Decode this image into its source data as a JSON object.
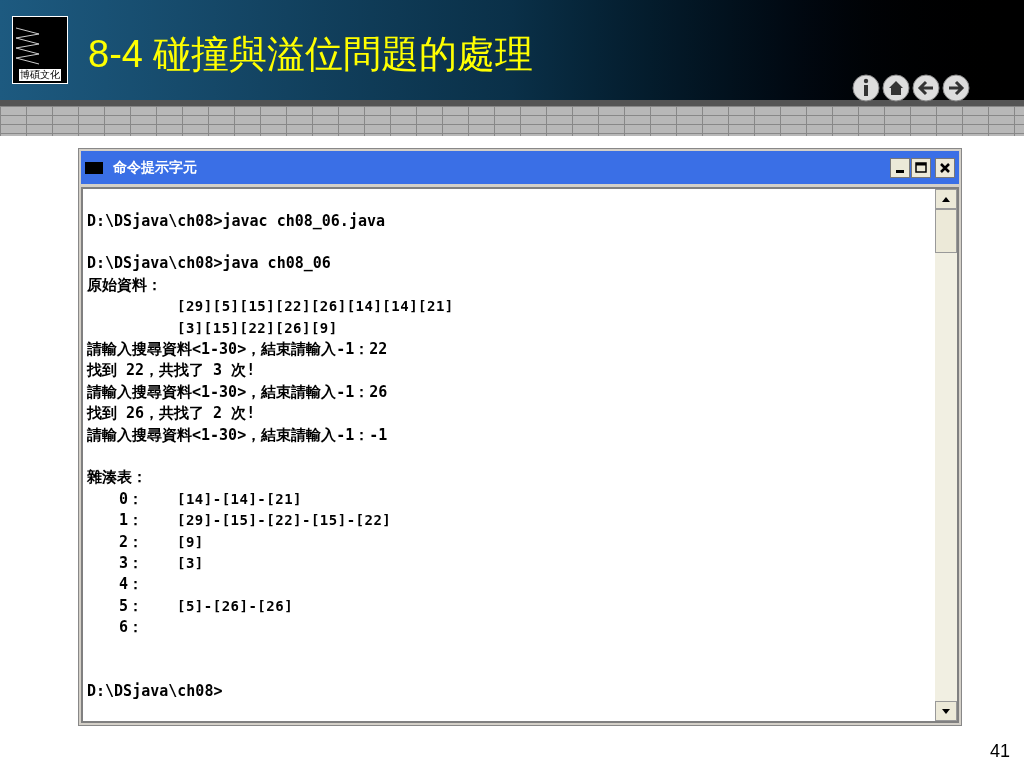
{
  "slide": {
    "logo_text": "博碩文化",
    "title": "8-4 碰撞與溢位問題的處理",
    "page_number": "41"
  },
  "window": {
    "title": "命令提示字元",
    "console": {
      "compile_command": "D:\\DSjava\\ch08>javac ch08_06.java",
      "run_command": "D:\\DSjava\\ch08>java ch08_06",
      "output_lines": [
        {
          "kind": "plain",
          "text": "原始資料："
        },
        {
          "kind": "indented",
          "text": "[29][5][15][22][26][14][14][21]"
        },
        {
          "kind": "indented",
          "text": "[3][15][22][26][9]"
        },
        {
          "kind": "plain",
          "text": "請輸入搜尋資料<1-30>，結束請輸入-1：22"
        },
        {
          "kind": "plain",
          "text": "找到 22，共找了 3 次!"
        },
        {
          "kind": "plain",
          "text": "請輸入搜尋資料<1-30>，結束請輸入-1：26"
        },
        {
          "kind": "plain",
          "text": "找到 26，共找了 2 次!"
        },
        {
          "kind": "plain",
          "text": "請輸入搜尋資料<1-30>，結束請輸入-1：-1"
        }
      ],
      "hash_table": {
        "title": "雜湊表：",
        "rows": [
          {
            "index": "0：",
            "values": "[14]-[14]-[21]"
          },
          {
            "index": "1：",
            "values": "[29]-[15]-[22]-[15]-[22]"
          },
          {
            "index": "2：",
            "values": "[9]"
          },
          {
            "index": "3：",
            "values": "[3]"
          },
          {
            "index": "4："
          },
          {
            "index": "5：",
            "values": "[5]-[26]-[26]"
          },
          {
            "index": "6："
          }
        ]
      },
      "prompt": "D:\\DSjava\\ch08>"
    }
  }
}
